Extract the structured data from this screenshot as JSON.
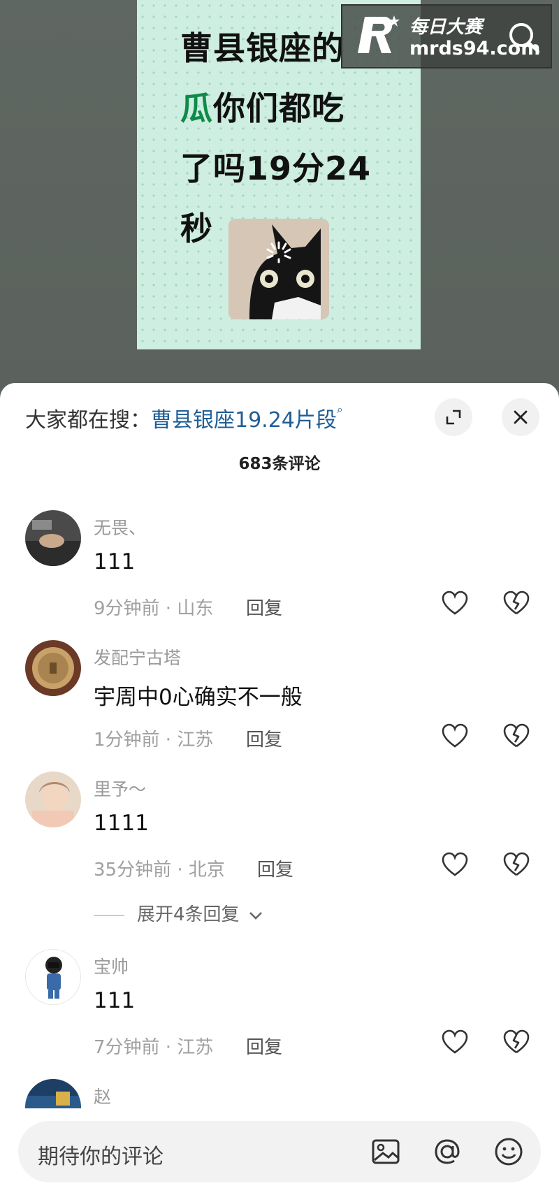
{
  "video": {
    "text_line1": "曹县银座的",
    "text_line2_green": "瓜",
    "text_line2": "你们都吃",
    "text_line3": "了吗19分24",
    "text_line4": "秒"
  },
  "watermark": {
    "title": "每日大赛",
    "url": "mrds94.com"
  },
  "panel": {
    "search_label": "大家都在搜：",
    "search_query": "曹县银座19.24片段",
    "comment_count": "683条评论"
  },
  "comments": [
    {
      "user": "无畏、",
      "text": "111",
      "meta": "9分钟前 · 山东",
      "reply": "回复"
    },
    {
      "user": "发配宁古塔",
      "text": "宇周中0心确实不一般",
      "meta": "1分钟前 · 江苏",
      "reply": "回复"
    },
    {
      "user": "里予～",
      "text": "1111",
      "meta": "35分钟前 · 北京",
      "reply": "回复",
      "expand": "展开4条回复"
    },
    {
      "user": "宝帅",
      "text": "111",
      "meta": "7分钟前 · 江苏",
      "reply": "回复"
    },
    {
      "user": "赵"
    }
  ],
  "input": {
    "placeholder": "期待你的评论"
  },
  "colors": {
    "link": "#1f5e96",
    "accent_green": "#0e8a4a"
  },
  "icons": [
    "search-icon",
    "expand-icon",
    "close-icon",
    "heart-icon",
    "broken-heart-icon",
    "image-icon",
    "at-icon",
    "emoji-icon"
  ]
}
